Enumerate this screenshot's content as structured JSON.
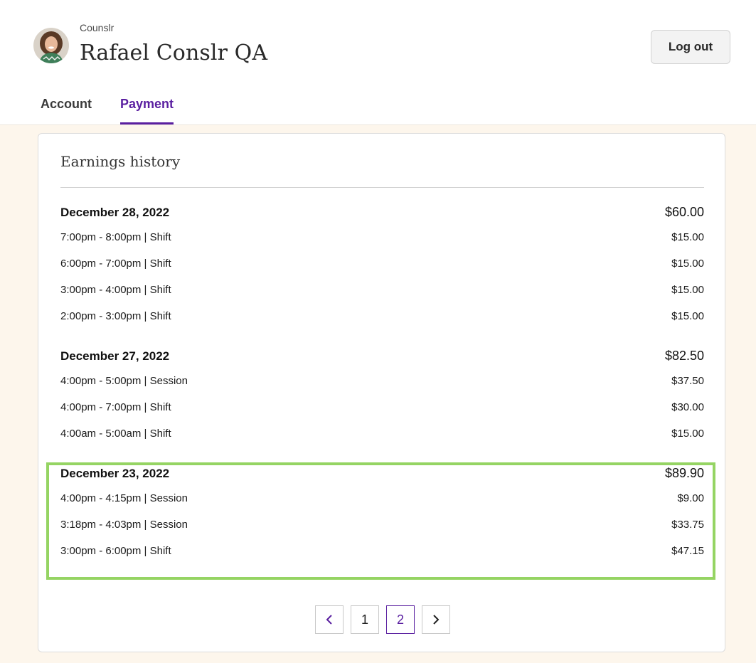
{
  "header": {
    "org_name": "Counslr",
    "user_name": "Rafael Conslr QA",
    "logout_label": "Log out"
  },
  "tabs": [
    {
      "label": "Account",
      "active": false
    },
    {
      "label": "Payment",
      "active": true
    }
  ],
  "earnings": {
    "title": "Earnings history",
    "days": [
      {
        "date": "December 28, 2022",
        "total": "$60.00",
        "entries": [
          {
            "label": "7:00pm - 8:00pm | Shift",
            "amount": "$15.00"
          },
          {
            "label": "6:00pm - 7:00pm | Shift",
            "amount": "$15.00"
          },
          {
            "label": "3:00pm - 4:00pm | Shift",
            "amount": "$15.00"
          },
          {
            "label": "2:00pm - 3:00pm | Shift",
            "amount": "$15.00"
          }
        ]
      },
      {
        "date": "December 27, 2022",
        "total": "$82.50",
        "entries": [
          {
            "label": "4:00pm - 5:00pm | Session",
            "amount": "$37.50"
          },
          {
            "label": "4:00pm - 7:00pm | Shift",
            "amount": "$30.00"
          },
          {
            "label": "4:00am - 5:00am | Shift",
            "amount": "$15.00"
          }
        ]
      },
      {
        "date": "December 23, 2022",
        "total": "$89.90",
        "entries": [
          {
            "label": "4:00pm - 4:15pm | Session",
            "amount": "$9.00"
          },
          {
            "label": "3:18pm - 4:03pm | Session",
            "amount": "$33.75"
          },
          {
            "label": "3:00pm - 6:00pm | Shift",
            "amount": "$47.15"
          }
        ]
      }
    ]
  },
  "pagination": {
    "prev_icon": "chevron-left-icon",
    "next_icon": "chevron-right-icon",
    "pages": [
      "1",
      "2"
    ],
    "current_page": "2"
  },
  "colors": {
    "accent": "#5a1fa0",
    "highlight": "#95d463",
    "page_background": "#fdf6ec"
  }
}
